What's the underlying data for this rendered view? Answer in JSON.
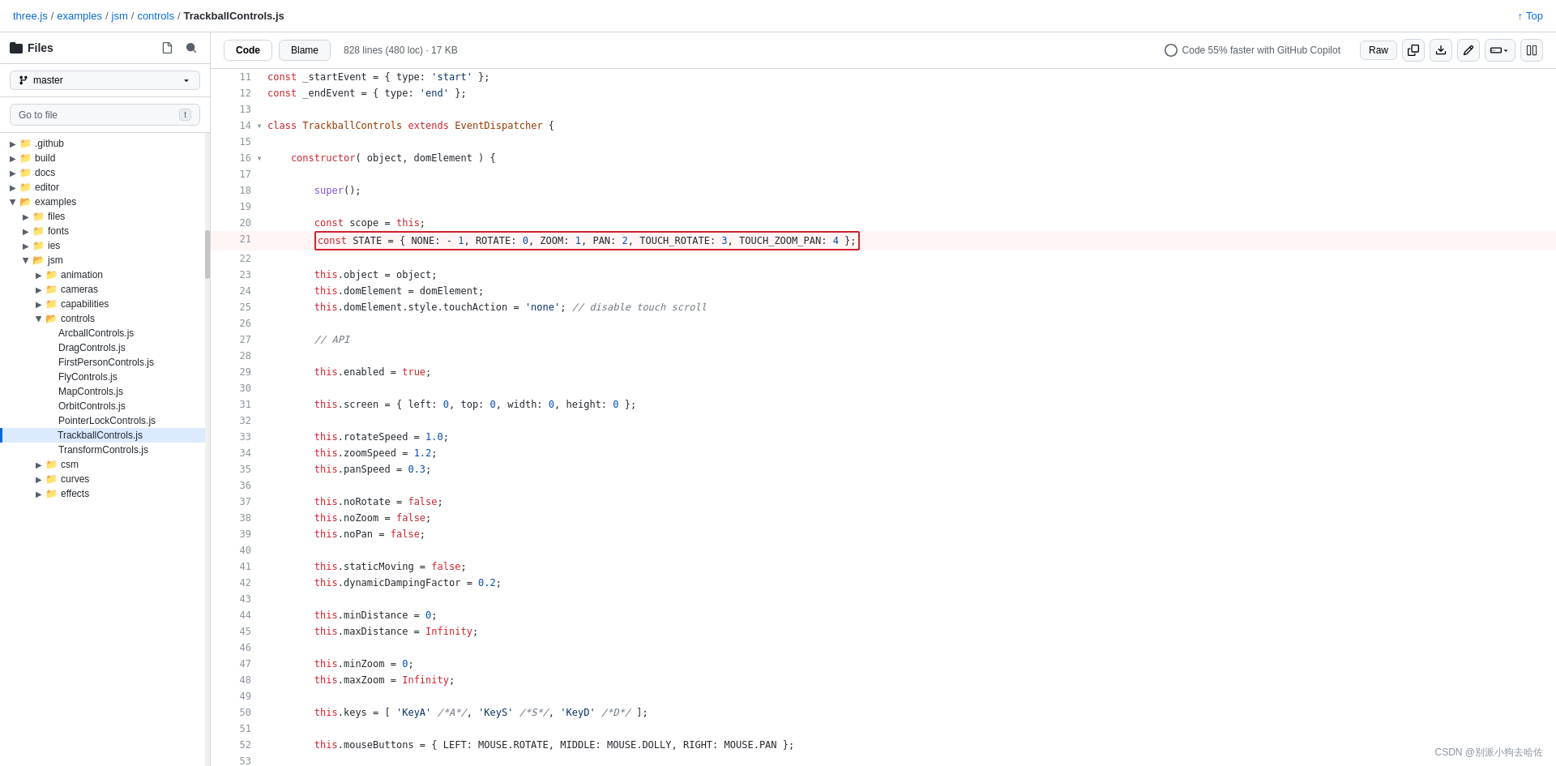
{
  "topBar": {
    "breadcrumb": [
      "three.js",
      "examples",
      "jsm",
      "controls",
      "TrackballControls.js"
    ],
    "topLink": "Top"
  },
  "codeToolbar": {
    "codeTab": "Code",
    "blameTab": "Blame",
    "fileMeta": "828 lines (480 loc) · 17 KB",
    "copilot": "Code 55% faster with GitHub Copilot",
    "rawBtn": "Raw"
  },
  "sidebar": {
    "title": "Files",
    "branch": "master",
    "goToFile": "Go to file",
    "shortcut": "t",
    "items": [
      {
        "name": ".github",
        "type": "folder",
        "indent": 0,
        "expanded": false
      },
      {
        "name": "build",
        "type": "folder",
        "indent": 0,
        "expanded": false
      },
      {
        "name": "docs",
        "type": "folder",
        "indent": 0,
        "expanded": false
      },
      {
        "name": "editor",
        "type": "folder",
        "indent": 0,
        "expanded": false
      },
      {
        "name": "examples",
        "type": "folder",
        "indent": 0,
        "expanded": true
      },
      {
        "name": "files",
        "type": "folder",
        "indent": 1,
        "expanded": false
      },
      {
        "name": "fonts",
        "type": "folder",
        "indent": 1,
        "expanded": false
      },
      {
        "name": "ies",
        "type": "folder",
        "indent": 1,
        "expanded": false
      },
      {
        "name": "jsm",
        "type": "folder",
        "indent": 1,
        "expanded": true
      },
      {
        "name": "animation",
        "type": "folder",
        "indent": 2,
        "expanded": false
      },
      {
        "name": "cameras",
        "type": "folder",
        "indent": 2,
        "expanded": false
      },
      {
        "name": "capabilities",
        "type": "folder",
        "indent": 2,
        "expanded": false
      },
      {
        "name": "controls",
        "type": "folder",
        "indent": 2,
        "expanded": true
      },
      {
        "name": "ArcballControls.js",
        "type": "file",
        "indent": 3
      },
      {
        "name": "DragControls.js",
        "type": "file",
        "indent": 3
      },
      {
        "name": "FirstPersonControls.js",
        "type": "file",
        "indent": 3
      },
      {
        "name": "FlyControls.js",
        "type": "file",
        "indent": 3
      },
      {
        "name": "MapControls.js",
        "type": "file",
        "indent": 3
      },
      {
        "name": "OrbitControls.js",
        "type": "file",
        "indent": 3
      },
      {
        "name": "PointerLockControls.js",
        "type": "file",
        "indent": 3
      },
      {
        "name": "TrackballControls.js",
        "type": "file",
        "indent": 3,
        "active": true
      },
      {
        "name": "TransformControls.js",
        "type": "file",
        "indent": 3
      },
      {
        "name": "csm",
        "type": "folder",
        "indent": 2,
        "expanded": false
      },
      {
        "name": "curves",
        "type": "folder",
        "indent": 2,
        "expanded": false
      },
      {
        "name": "effects",
        "type": "folder",
        "indent": 2,
        "expanded": false
      }
    ]
  },
  "codeLines": [
    {
      "num": 11,
      "code": "    const _startEvent = { type: 'start' };",
      "tokens": [
        {
          "t": "kw",
          "v": "const"
        },
        {
          "t": "",
          "v": " _startEvent = { type: "
        },
        {
          "t": "str",
          "v": "'start'"
        },
        {
          "t": "",
          "v": " };"
        }
      ]
    },
    {
      "num": 12,
      "code": "    const _endEvent = { type: 'end' };",
      "tokens": [
        {
          "t": "kw",
          "v": "const"
        },
        {
          "t": "",
          "v": " _endEvent = { type: "
        },
        {
          "t": "str",
          "v": "'end'"
        },
        {
          "t": "",
          "v": " };"
        }
      ]
    },
    {
      "num": 13,
      "code": ""
    },
    {
      "num": 14,
      "expand": true,
      "code": "class TrackballControls extends EventDispatcher {",
      "tokens": [
        {
          "t": "kw",
          "v": "class"
        },
        {
          "t": "",
          "v": " "
        },
        {
          "t": "cls",
          "v": "TrackballControls"
        },
        {
          "t": "",
          "v": " "
        },
        {
          "t": "kw",
          "v": "extends"
        },
        {
          "t": "",
          "v": " "
        },
        {
          "t": "cls",
          "v": "EventDispatcher"
        },
        {
          "t": "",
          "v": " {"
        }
      ]
    },
    {
      "num": 15,
      "code": ""
    },
    {
      "num": 16,
      "expand": true,
      "indent": "    ",
      "code": "    constructor( object, domElement ) {",
      "tokens": [
        {
          "t": "kw",
          "v": "    constructor"
        },
        {
          "t": "",
          "v": "( object, domElement ) {"
        }
      ]
    },
    {
      "num": 17,
      "code": ""
    },
    {
      "num": 18,
      "code": "        super();",
      "tokens": [
        {
          "t": "fn",
          "v": "        super"
        },
        {
          "t": "",
          "v": "();"
        }
      ]
    },
    {
      "num": 19,
      "code": ""
    },
    {
      "num": 20,
      "code": "        const scope = this;",
      "tokens": [
        {
          "t": "kw",
          "v": "        const"
        },
        {
          "t": "",
          "v": " scope = "
        },
        {
          "t": "kw",
          "v": "this"
        },
        {
          "t": "",
          "v": ";"
        }
      ]
    },
    {
      "num": 21,
      "code": "        const STATE = { NONE: - 1, ROTATE: 0, ZOOM: 1, PAN: 2, TOUCH_ROTATE: 3, TOUCH_ZOOM_PAN: 4 };",
      "highlighted": true,
      "tokens": [
        {
          "t": "kw",
          "v": "const"
        },
        {
          "t": "",
          "v": " STATE = { NONE: - "
        },
        {
          "t": "num",
          "v": "1"
        },
        {
          "t": "",
          "v": ", ROTATE: "
        },
        {
          "t": "num",
          "v": "0"
        },
        {
          "t": "",
          "v": ", ZOOM: "
        },
        {
          "t": "num",
          "v": "1"
        },
        {
          "t": "",
          "v": ", PAN: "
        },
        {
          "t": "num",
          "v": "2"
        },
        {
          "t": "",
          "v": ", TOUCH_ROTATE: "
        },
        {
          "t": "num",
          "v": "3"
        },
        {
          "t": "",
          "v": ", TOUCH_ZOOM_PAN: "
        },
        {
          "t": "num",
          "v": "4"
        },
        {
          "t": "",
          "v": " };"
        }
      ]
    },
    {
      "num": 22,
      "code": ""
    },
    {
      "num": 23,
      "code": "        this.object = object;",
      "tokens": [
        {
          "t": "kw",
          "v": "        this"
        },
        {
          "t": "",
          "v": ".object = object;"
        }
      ]
    },
    {
      "num": 24,
      "code": "        this.domElement = domElement;",
      "tokens": [
        {
          "t": "kw",
          "v": "        this"
        },
        {
          "t": "",
          "v": ".domElement = domElement;"
        }
      ]
    },
    {
      "num": 25,
      "code": "        this.domElement.style.touchAction = 'none'; // disable touch scroll",
      "tokens": [
        {
          "t": "kw",
          "v": "        this"
        },
        {
          "t": "",
          "v": ".domElement.style.touchAction = "
        },
        {
          "t": "str",
          "v": "'none'"
        },
        {
          "t": "",
          "v": "; "
        },
        {
          "t": "cm",
          "v": "// disable touch scroll"
        }
      ]
    },
    {
      "num": 26,
      "code": ""
    },
    {
      "num": 27,
      "code": "        // API",
      "tokens": [
        {
          "t": "cm",
          "v": "        // API"
        }
      ]
    },
    {
      "num": 28,
      "code": ""
    },
    {
      "num": 29,
      "code": "        this.enabled = true;",
      "tokens": [
        {
          "t": "kw",
          "v": "        this"
        },
        {
          "t": "",
          "v": ".enabled = "
        },
        {
          "t": "kw",
          "v": "true"
        },
        {
          "t": "",
          "v": ";"
        }
      ]
    },
    {
      "num": 30,
      "code": ""
    },
    {
      "num": 31,
      "code": "        this.screen = { left: 0, top: 0, width: 0, height: 0 };",
      "tokens": [
        {
          "t": "kw",
          "v": "        this"
        },
        {
          "t": "",
          "v": ".screen = { left: "
        },
        {
          "t": "num",
          "v": "0"
        },
        {
          "t": "",
          "v": ", top: "
        },
        {
          "t": "num",
          "v": "0"
        },
        {
          "t": "",
          "v": ", width: "
        },
        {
          "t": "num",
          "v": "0"
        },
        {
          "t": "",
          "v": ", height: "
        },
        {
          "t": "num",
          "v": "0"
        },
        {
          "t": "",
          "v": " };"
        }
      ]
    },
    {
      "num": 32,
      "code": ""
    },
    {
      "num": 33,
      "code": "        this.rotateSpeed = 1.0;",
      "tokens": [
        {
          "t": "kw",
          "v": "        this"
        },
        {
          "t": "",
          "v": ".rotateSpeed = "
        },
        {
          "t": "num",
          "v": "1.0"
        },
        {
          "t": "",
          "v": ";"
        }
      ]
    },
    {
      "num": 34,
      "code": "        this.zoomSpeed = 1.2;",
      "tokens": [
        {
          "t": "kw",
          "v": "        this"
        },
        {
          "t": "",
          "v": ".zoomSpeed = "
        },
        {
          "t": "num",
          "v": "1.2"
        },
        {
          "t": "",
          "v": ";"
        }
      ]
    },
    {
      "num": 35,
      "code": "        this.panSpeed = 0.3;",
      "tokens": [
        {
          "t": "kw",
          "v": "        this"
        },
        {
          "t": "",
          "v": ".panSpeed = "
        },
        {
          "t": "num",
          "v": "0.3"
        },
        {
          "t": "",
          "v": ";"
        }
      ]
    },
    {
      "num": 36,
      "code": ""
    },
    {
      "num": 37,
      "code": "        this.noRotate = false;",
      "tokens": [
        {
          "t": "kw",
          "v": "        this"
        },
        {
          "t": "",
          "v": ".noRotate = "
        },
        {
          "t": "kw",
          "v": "false"
        },
        {
          "t": "",
          "v": ";"
        }
      ]
    },
    {
      "num": 38,
      "code": "        this.noZoom = false;",
      "tokens": [
        {
          "t": "kw",
          "v": "        this"
        },
        {
          "t": "",
          "v": ".noZoom = "
        },
        {
          "t": "kw",
          "v": "false"
        },
        {
          "t": "",
          "v": ";"
        }
      ]
    },
    {
      "num": 39,
      "code": "        this.noPan = false;",
      "tokens": [
        {
          "t": "kw",
          "v": "        this"
        },
        {
          "t": "",
          "v": ".noPan = "
        },
        {
          "t": "kw",
          "v": "false"
        },
        {
          "t": "",
          "v": ";"
        }
      ]
    },
    {
      "num": 40,
      "code": ""
    },
    {
      "num": 41,
      "code": "        this.staticMoving = false;",
      "tokens": [
        {
          "t": "kw",
          "v": "        this"
        },
        {
          "t": "",
          "v": ".staticMoving = "
        },
        {
          "t": "kw",
          "v": "false"
        },
        {
          "t": "",
          "v": ";"
        }
      ]
    },
    {
      "num": 42,
      "code": "        this.dynamicDampingFactor = 0.2;",
      "tokens": [
        {
          "t": "kw",
          "v": "        this"
        },
        {
          "t": "",
          "v": ".dynamicDampingFactor = "
        },
        {
          "t": "num",
          "v": "0.2"
        },
        {
          "t": "",
          "v": ";"
        }
      ]
    },
    {
      "num": 43,
      "code": ""
    },
    {
      "num": 44,
      "code": "        this.minDistance = 0;",
      "tokens": [
        {
          "t": "kw",
          "v": "        this"
        },
        {
          "t": "",
          "v": ".minDistance = "
        },
        {
          "t": "num",
          "v": "0"
        },
        {
          "t": "",
          "v": ";"
        }
      ]
    },
    {
      "num": 45,
      "code": "        this.maxDistance = Infinity;",
      "tokens": [
        {
          "t": "kw",
          "v": "        this"
        },
        {
          "t": "",
          "v": ".maxDistance = "
        },
        {
          "t": "kw",
          "v": "Infinity"
        },
        {
          "t": "",
          "v": ";"
        }
      ]
    },
    {
      "num": 46,
      "code": ""
    },
    {
      "num": 47,
      "code": "        this.minZoom = 0;",
      "tokens": [
        {
          "t": "kw",
          "v": "        this"
        },
        {
          "t": "",
          "v": ".minZoom = "
        },
        {
          "t": "num",
          "v": "0"
        },
        {
          "t": "",
          "v": ";"
        }
      ]
    },
    {
      "num": 48,
      "code": "        this.maxZoom = Infinity;",
      "tokens": [
        {
          "t": "kw",
          "v": "        this"
        },
        {
          "t": "",
          "v": ".maxZoom = "
        },
        {
          "t": "kw",
          "v": "Infinity"
        },
        {
          "t": "",
          "v": ";"
        }
      ]
    },
    {
      "num": 49,
      "code": ""
    },
    {
      "num": 50,
      "code": "        this.keys = [ 'KeyA' /*A*/, 'KeyS' /*S*/, 'KeyD' /*D*/ ];",
      "tokens": [
        {
          "t": "kw",
          "v": "        this"
        },
        {
          "t": "",
          "v": ".keys = [ "
        },
        {
          "t": "str",
          "v": "'KeyA'"
        },
        {
          "t": "",
          "v": " "
        },
        {
          "t": "cm",
          "v": "/*A*/"
        },
        {
          "t": "",
          "v": ", "
        },
        {
          "t": "str",
          "v": "'KeyS'"
        },
        {
          "t": "",
          "v": " "
        },
        {
          "t": "cm",
          "v": "/*S*/"
        },
        {
          "t": "",
          "v": ", "
        },
        {
          "t": "str",
          "v": "'KeyD'"
        },
        {
          "t": "",
          "v": " "
        },
        {
          "t": "cm",
          "v": "/*D*/"
        },
        {
          "t": "",
          "v": " ];"
        }
      ]
    },
    {
      "num": 51,
      "code": ""
    },
    {
      "num": 52,
      "code": "        this.mouseButtons = { LEFT: MOUSE.ROTATE, MIDDLE: MOUSE.DOLLY, RIGHT: MOUSE.PAN };",
      "tokens": [
        {
          "t": "kw",
          "v": "        this"
        },
        {
          "t": "",
          "v": ".mouseButtons = { LEFT: MOUSE.ROTATE, MIDDLE: MOUSE.DOLLY, RIGHT: MOUSE.PAN };"
        }
      ]
    },
    {
      "num": 53,
      "code": ""
    }
  ],
  "watermark": "CSDN @别派小狗去哈佐"
}
